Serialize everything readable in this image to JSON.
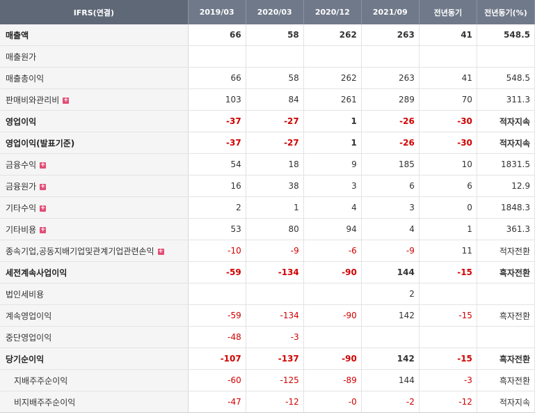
{
  "header": [
    "IFRS(연결)",
    "2019/03",
    "2020/03",
    "2020/12",
    "2021/09",
    "전년동기",
    "전년동기(%)"
  ],
  "rows": [
    {
      "label": "매출액",
      "bold": true,
      "expand": false,
      "indent": false,
      "cells": [
        "66",
        "58",
        "262",
        "263",
        "41",
        "548.5"
      ]
    },
    {
      "label": "매출원가",
      "bold": false,
      "expand": false,
      "indent": false,
      "cells": [
        "",
        "",
        "",
        "",
        "",
        ""
      ]
    },
    {
      "label": "매출총이익",
      "bold": false,
      "expand": false,
      "indent": false,
      "cells": [
        "66",
        "58",
        "262",
        "263",
        "41",
        "548.5"
      ]
    },
    {
      "label": "판매비와관리비",
      "bold": false,
      "expand": true,
      "indent": false,
      "cells": [
        "103",
        "84",
        "261",
        "289",
        "70",
        "311.3"
      ]
    },
    {
      "label": "영업이익",
      "bold": true,
      "expand": false,
      "indent": false,
      "cells": [
        "-37",
        "-27",
        "1",
        "-26",
        "-30",
        "적자지속"
      ]
    },
    {
      "label": "영업이익(발표기준)",
      "bold": true,
      "expand": false,
      "indent": false,
      "cells": [
        "-37",
        "-27",
        "1",
        "-26",
        "-30",
        "적자지속"
      ]
    },
    {
      "label": "금융수익",
      "bold": false,
      "expand": true,
      "indent": false,
      "cells": [
        "54",
        "18",
        "9",
        "185",
        "10",
        "1831.5"
      ]
    },
    {
      "label": "금융원가",
      "bold": false,
      "expand": true,
      "indent": false,
      "cells": [
        "16",
        "38",
        "3",
        "6",
        "6",
        "12.9"
      ]
    },
    {
      "label": "기타수익",
      "bold": false,
      "expand": true,
      "indent": false,
      "cells": [
        "2",
        "1",
        "4",
        "3",
        "0",
        "1848.3"
      ]
    },
    {
      "label": "기타비용",
      "bold": false,
      "expand": true,
      "indent": false,
      "cells": [
        "53",
        "80",
        "94",
        "4",
        "1",
        "361.3"
      ]
    },
    {
      "label": "종속기업,공동지배기업및관계기업관련손익",
      "bold": false,
      "expand": true,
      "indent": false,
      "cells": [
        "-10",
        "-9",
        "-6",
        "-9",
        "11",
        "적자전환"
      ]
    },
    {
      "label": "세전계속사업이익",
      "bold": true,
      "expand": false,
      "indent": false,
      "cells": [
        "-59",
        "-134",
        "-90",
        "144",
        "-15",
        "흑자전환"
      ]
    },
    {
      "label": "법인세비용",
      "bold": false,
      "expand": false,
      "indent": false,
      "cells": [
        "",
        "",
        "",
        "2",
        "",
        ""
      ]
    },
    {
      "label": "계속영업이익",
      "bold": false,
      "expand": false,
      "indent": false,
      "cells": [
        "-59",
        "-134",
        "-90",
        "142",
        "-15",
        "흑자전환"
      ]
    },
    {
      "label": "중단영업이익",
      "bold": false,
      "expand": false,
      "indent": false,
      "cells": [
        "-48",
        "-3",
        "",
        "",
        "",
        ""
      ]
    },
    {
      "label": "당기순이익",
      "bold": true,
      "expand": false,
      "indent": false,
      "cells": [
        "-107",
        "-137",
        "-90",
        "142",
        "-15",
        "흑자전환"
      ]
    },
    {
      "label": "지배주주순이익",
      "bold": false,
      "expand": false,
      "indent": true,
      "cells": [
        "-60",
        "-125",
        "-89",
        "144",
        "-3",
        "흑자전환"
      ]
    },
    {
      "label": "비지배주주순이익",
      "bold": false,
      "expand": false,
      "indent": true,
      "cells": [
        "-47",
        "-12",
        "-0",
        "-2",
        "-12",
        "적자지속"
      ]
    }
  ],
  "expand_glyph": "+"
}
